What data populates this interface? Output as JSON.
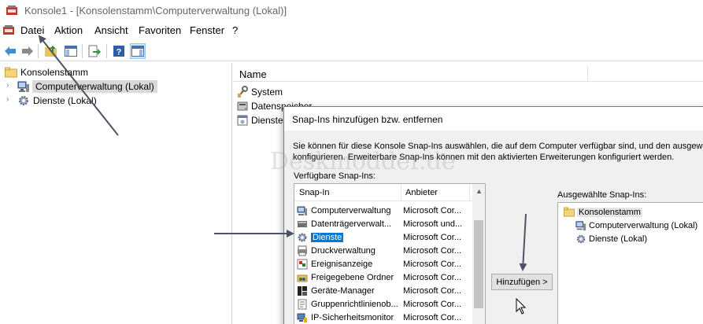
{
  "window": {
    "title": "Konsole1 - [Konsolenstamm\\Computerverwaltung (Lokal)]"
  },
  "menu": {
    "items": [
      "Datei",
      "Aktion",
      "Ansicht",
      "Favoriten",
      "Fenster",
      "?"
    ]
  },
  "toolbar": {
    "buttons": [
      "back-icon",
      "forward-icon",
      "up-folder-icon",
      "show-hide-tree-icon",
      "export-list-icon",
      "help-icon",
      "show-hide-action-pane-icon"
    ]
  },
  "tree": {
    "root": "Konsolenstamm",
    "items": [
      {
        "label": "Computerverwaltung (Lokal)",
        "selected": true
      },
      {
        "label": "Dienste (Lokal)",
        "selected": false
      }
    ]
  },
  "result": {
    "column_header": "Name",
    "rows": [
      "System",
      "Datenspeicher",
      "Dienste"
    ]
  },
  "dialog": {
    "title": "Snap-Ins hinzufügen bzw. entfernen",
    "description_line1": "Sie können für diese Konsole Snap-Ins auswählen, die auf dem Computer verfügbar sind, und den ausgewählten Satz von Snap-Ins",
    "description_line2": "konfigurieren. Erweiterbare Snap-Ins können mit den aktivierten Erweiterungen konfiguriert werden.",
    "available_label": "Verfügbare Snap-Ins:",
    "selected_label": "Ausgewählte Snap-Ins:",
    "columns": {
      "snapin": "Snap-In",
      "vendor": "Anbieter"
    },
    "available": [
      {
        "name": "Computerverwaltung",
        "vendor": "Microsoft Cor...",
        "icon": "computer-management-icon"
      },
      {
        "name": "Datenträgerverwalt...",
        "vendor": "Microsoft und...",
        "icon": "disk-management-icon"
      },
      {
        "name": "Dienste",
        "vendor": "Microsoft Cor...",
        "icon": "services-icon",
        "selected": true
      },
      {
        "name": "Druckverwaltung",
        "vendor": "Microsoft Cor...",
        "icon": "print-management-icon"
      },
      {
        "name": "Ereignisanzeige",
        "vendor": "Microsoft Cor...",
        "icon": "event-viewer-icon"
      },
      {
        "name": "Freigegebene Ordner",
        "vendor": "Microsoft Cor...",
        "icon": "shared-folders-icon"
      },
      {
        "name": "Geräte-Manager",
        "vendor": "Microsoft Cor...",
        "icon": "device-manager-icon"
      },
      {
        "name": "Gruppenrichtlinienob...",
        "vendor": "Microsoft Cor...",
        "icon": "group-policy-icon"
      },
      {
        "name": "IP-Sicherheitsmonitor",
        "vendor": "Microsoft Cor...",
        "icon": "ip-security-icon"
      }
    ],
    "add_button": "Hinzufügen >",
    "selected": {
      "root": "Konsolenstamm",
      "items": [
        "Computerverwaltung (Lokal)",
        "Dienste (Lokal)"
      ]
    }
  },
  "watermark": "Deskmodder.de",
  "colors": {
    "selection_blue": "#0078d7",
    "annotation_arrow": "#4d5463"
  }
}
